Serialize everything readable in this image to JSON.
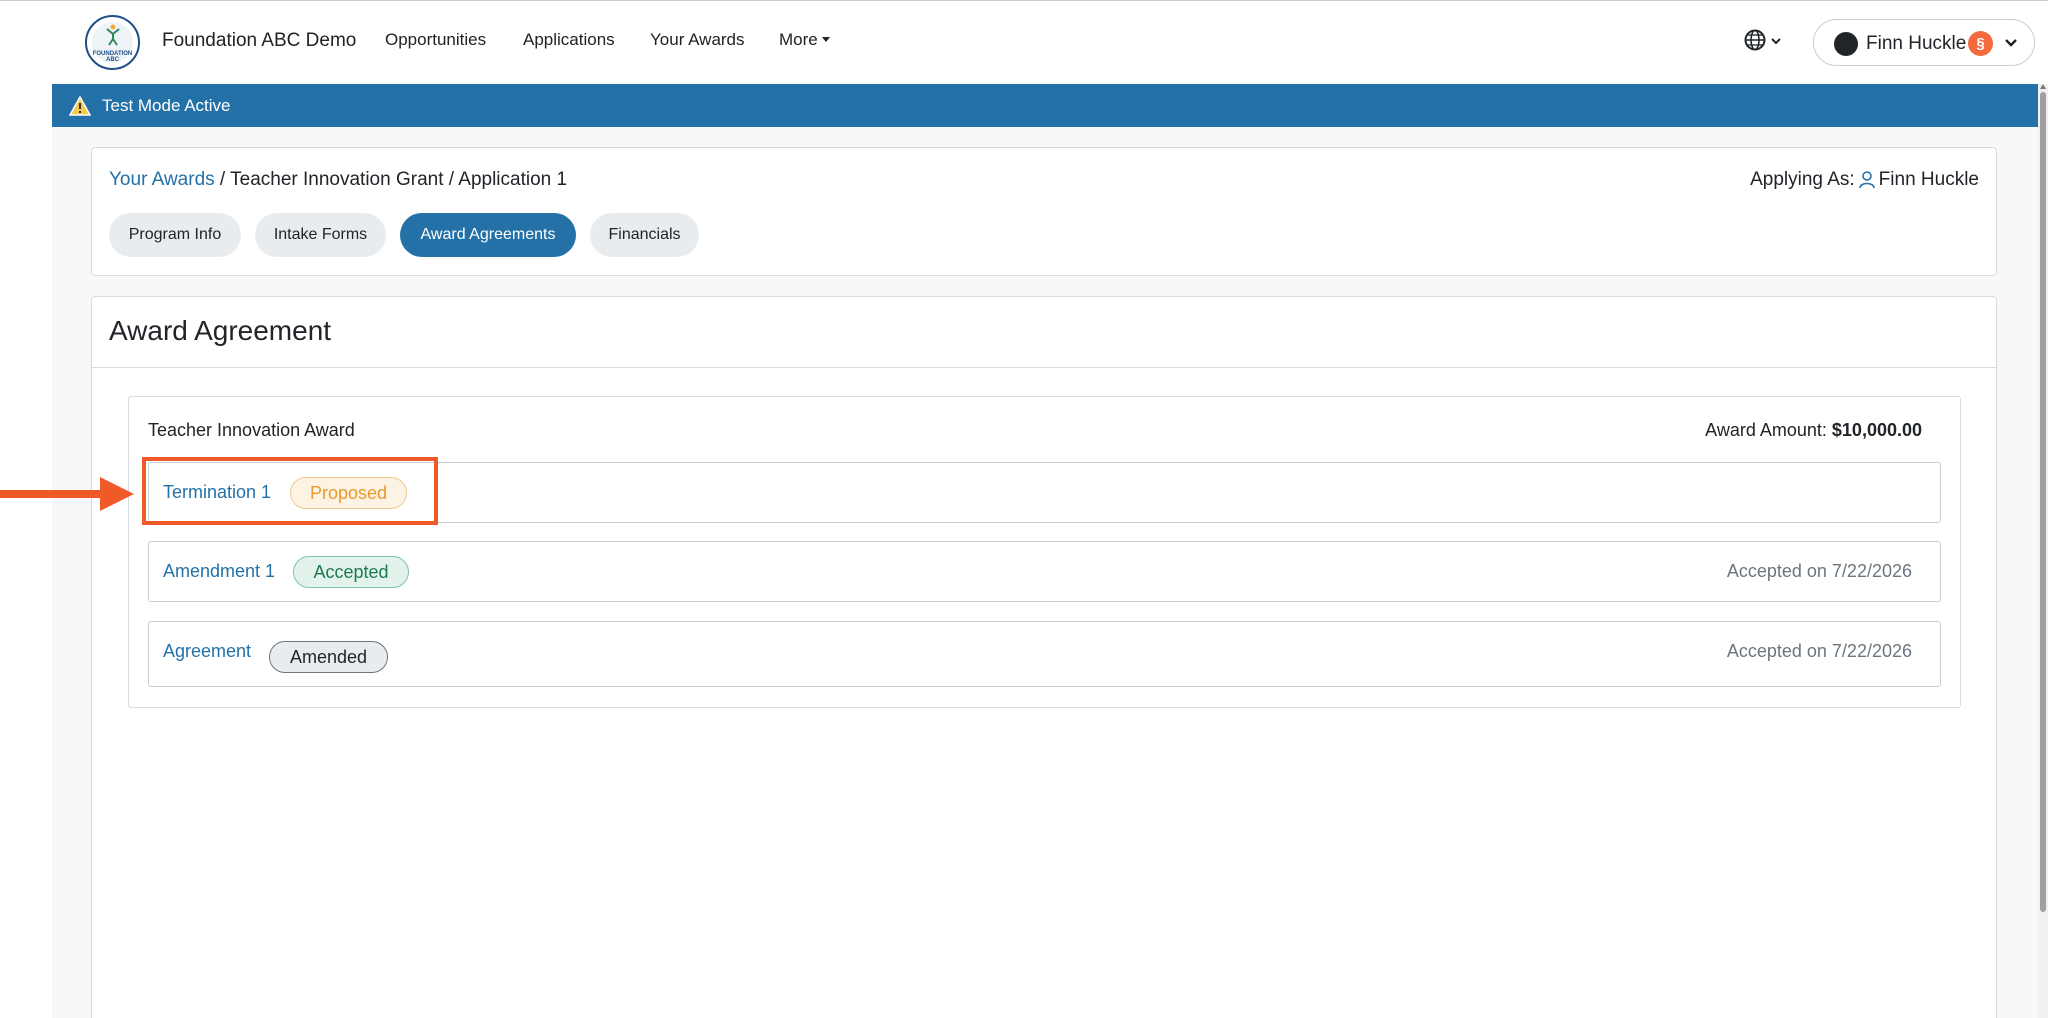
{
  "navbar": {
    "brand": "Foundation ABC Demo",
    "logo_text": "FOUNDATION ABC",
    "links": [
      "Opportunities",
      "Applications",
      "Your Awards",
      "More"
    ],
    "language_icon": "globe-icon",
    "user": {
      "name": "Finn Huckle",
      "notification_glyph": "§"
    }
  },
  "banner": {
    "label": "Test Mode Active",
    "icon": "warning-icon"
  },
  "breadcrumb": {
    "root": "Your Awards",
    "separator": " / ",
    "rest": "Teacher Innovation Grant / Application 1"
  },
  "applying_as": {
    "label": "Applying As:",
    "name": "Finn Huckle"
  },
  "tabs": [
    "Program Info",
    "Intake Forms",
    "Award Agreements",
    "Financials"
  ],
  "active_tab": "Award Agreements",
  "section_title": "Award Agreement",
  "award": {
    "name": "Teacher Innovation Award",
    "amount_label": "Award Amount:",
    "amount_value": "$10,000.00"
  },
  "agreements": [
    {
      "name": "Termination 1",
      "status": "Proposed",
      "date": ""
    },
    {
      "name": "Amendment 1",
      "status": "Accepted",
      "date": "Accepted on 7/22/2026"
    },
    {
      "name": "Agreement",
      "status": "Amended",
      "date": "Accepted on 7/22/2026"
    }
  ],
  "colors": {
    "primary": "#2471a8",
    "highlight": "#f05a28",
    "proposed": "#e89a2e",
    "accepted": "#1b7a55"
  }
}
